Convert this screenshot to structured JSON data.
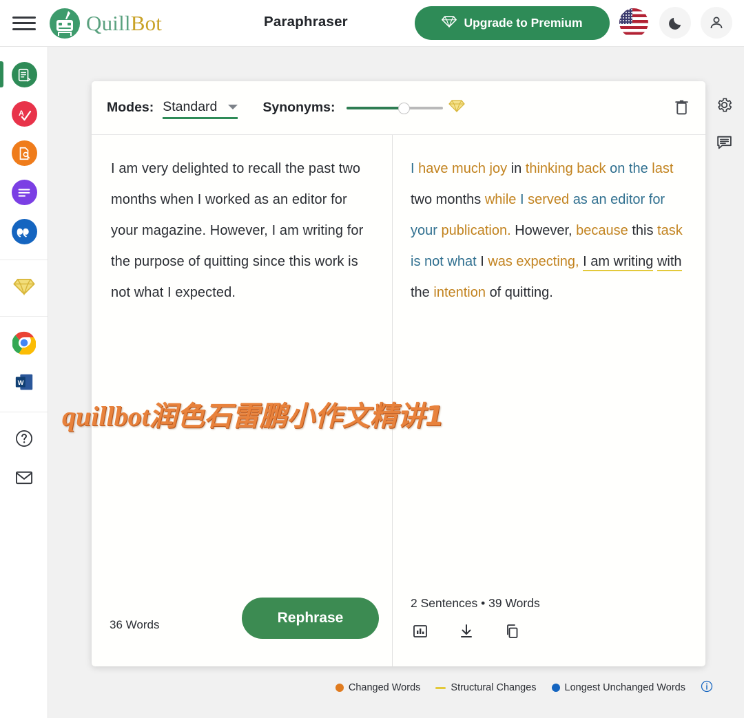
{
  "header": {
    "menu_icon": "hamburger-menu-icon",
    "logo_quill": "Quill",
    "logo_bot": "Bot",
    "page_title": "Paraphraser",
    "upgrade_label": "Upgrade to Premium",
    "upgrade_icon": "diamond-icon",
    "flag_icon": "us-flag-icon",
    "dark_mode_icon": "moon-icon",
    "account_icon": "account-person-icon",
    "upgrade_color": "#2e8b57"
  },
  "sidebar": {
    "tools": [
      {
        "name": "paraphraser",
        "label": "Paraphraser",
        "icon": "paraphraser-icon",
        "color": "#2e8b57",
        "active": true
      },
      {
        "name": "grammar-checker",
        "label": "Grammar Checker",
        "icon": "grammar-check-icon",
        "color": "#e8334a",
        "active": false
      },
      {
        "name": "plagiarism-checker",
        "label": "Plagiarism Checker",
        "icon": "plagiarism-icon",
        "color": "#ef7c1b",
        "active": false
      },
      {
        "name": "summarizer",
        "label": "Summarizer",
        "icon": "summarizer-icon",
        "color": "#7b3fe4",
        "active": false
      },
      {
        "name": "citation-generator",
        "label": "Citation Generator",
        "icon": "quote-icon",
        "color": "#1565c0",
        "active": false
      }
    ],
    "premium": {
      "name": "premium",
      "label": "Premium",
      "icon": "diamond-icon",
      "color": "#e8c547"
    },
    "extensions": [
      {
        "name": "chrome-extension",
        "label": "Chrome Extension",
        "icon": "chrome-icon"
      },
      {
        "name": "word-addin",
        "label": "Word Add-in",
        "icon": "ms-word-icon"
      }
    ],
    "utility": [
      {
        "name": "help",
        "label": "Help",
        "icon": "question-circle-icon"
      },
      {
        "name": "contact",
        "label": "Contact",
        "icon": "mail-icon"
      }
    ]
  },
  "right_rail": [
    {
      "name": "settings",
      "label": "Settings",
      "icon": "gear-icon"
    },
    {
      "name": "feedback",
      "label": "Feedback",
      "icon": "comment-icon"
    }
  ],
  "toolbar": {
    "modes_label": "Modes:",
    "mode_value": "Standard",
    "mode_caret": "chevron-down-icon",
    "synonyms_label": "Synonyms:",
    "synonyms_value": 62,
    "synonyms_gem": "diamond-icon",
    "delete_icon": "trash-icon"
  },
  "input_pane": {
    "text": "I am very delighted to recall the past two months when I worked as an editor for your magazine. However, I am writing for the purpose of quitting since this work is not what I expected.",
    "word_count": "36 Words",
    "rephrase_label": "Rephrase"
  },
  "output_pane": {
    "tokens": [
      {
        "t": "I",
        "c": "blue"
      },
      {
        "t": "have much joy",
        "c": "orange"
      },
      {
        "t": "in",
        "c": "dark"
      },
      {
        "t": "thinking back",
        "c": "orange"
      },
      {
        "t": "on the",
        "c": "blue"
      },
      {
        "t": "last",
        "c": "orange"
      },
      {
        "t": "two months",
        "c": "dark"
      },
      {
        "t": "while",
        "c": "orange"
      },
      {
        "t": "I",
        "c": "blue"
      },
      {
        "t": "served",
        "c": "orange"
      },
      {
        "t": "as an editor for your",
        "c": "blue"
      },
      {
        "t": "publication.",
        "c": "orange"
      },
      {
        "t": "However,",
        "c": "dark"
      },
      {
        "t": "because",
        "c": "orange"
      },
      {
        "t": "this",
        "c": "dark"
      },
      {
        "t": "task",
        "c": "orange"
      },
      {
        "t": "is not",
        "c": "blue"
      },
      {
        "t": "what",
        "c": "blue"
      },
      {
        "t": "I",
        "c": "dark"
      },
      {
        "t": "was expecting,",
        "c": "orange"
      },
      {
        "t": "I am writing",
        "c": "struct"
      },
      {
        "t": "with",
        "c": "struct-orange"
      },
      {
        "t": "the",
        "c": "dark"
      },
      {
        "t": "intention",
        "c": "orange"
      },
      {
        "t": "of quitting.",
        "c": "dark"
      }
    ],
    "stats": "2 Sentences  •  39 Words",
    "icons": [
      {
        "name": "statistics",
        "label": "Statistics",
        "icon": "bar-chart-icon"
      },
      {
        "name": "download",
        "label": "Download",
        "icon": "download-icon"
      },
      {
        "name": "copy",
        "label": "Copy",
        "icon": "copy-icon"
      }
    ]
  },
  "legend": {
    "changed_words": "Changed Words",
    "structural_changes": "Structural Changes",
    "longest_unchanged": "Longest Unchanged Words",
    "info_icon": "info-circle-icon",
    "changed_color": "#e07b1f",
    "structural_color": "#e3c93a",
    "unchanged_color": "#1565c0"
  },
  "watermark": {
    "latin": "quillbot",
    "cjk": "润色石雷鹏小作文精讲1"
  }
}
